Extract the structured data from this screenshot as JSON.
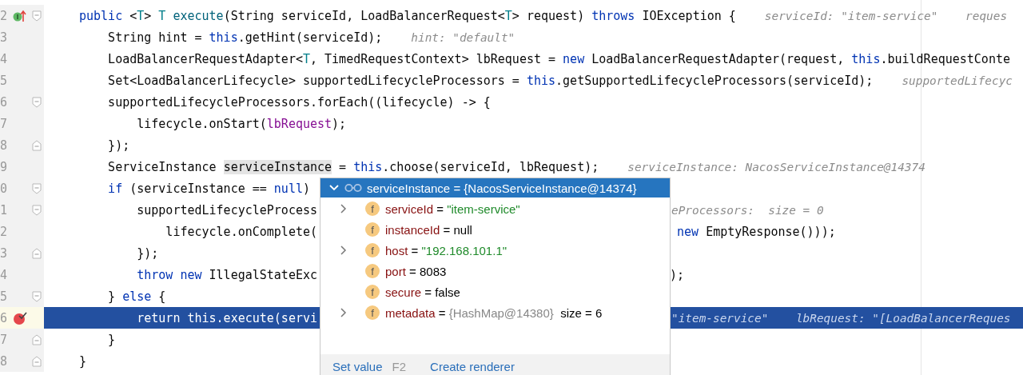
{
  "editor": {
    "lines": [
      {
        "number": "2",
        "gutter_icon": {
          "kind": "implements"
        },
        "fold": {
          "kind": "start"
        },
        "current": false,
        "code": [
          {
            "kind": "kw",
            "t": "public "
          },
          {
            "kind": "text",
            "t": "<"
          },
          {
            "kind": "type",
            "t": "T"
          },
          {
            "kind": "text",
            "t": "> "
          },
          {
            "kind": "type",
            "t": "T "
          },
          {
            "kind": "fn",
            "t": "execute"
          },
          {
            "kind": "text",
            "t": "(String serviceId, LoadBalancerRequest<"
          },
          {
            "kind": "type",
            "t": "T"
          },
          {
            "kind": "text",
            "t": "> request) "
          },
          {
            "kind": "kw",
            "t": "throws "
          },
          {
            "kind": "text",
            "t": "IOException {"
          }
        ],
        "hint": "serviceId: \"item-service\"    reques"
      },
      {
        "number": "3",
        "current": false,
        "code": [
          {
            "kind": "text",
            "t": "    String hint = "
          },
          {
            "kind": "kw",
            "t": "this"
          },
          {
            "kind": "text",
            "t": ".getHint(serviceId);"
          }
        ],
        "hint": "hint: \"default\""
      },
      {
        "number": "4",
        "current": false,
        "code": [
          {
            "kind": "text",
            "t": "    LoadBalancerRequestAdapter<"
          },
          {
            "kind": "type",
            "t": "T"
          },
          {
            "kind": "text",
            "t": ", TimedRequestContext> lbRequest = "
          },
          {
            "kind": "kw",
            "t": "new "
          },
          {
            "kind": "text",
            "t": "LoadBalancerRequestAdapter(request, "
          },
          {
            "kind": "kw",
            "t": "this"
          },
          {
            "kind": "text",
            "t": ".buildRequestConte"
          }
        ]
      },
      {
        "number": "5",
        "current": false,
        "code": [
          {
            "kind": "text",
            "t": "    Set<LoadBalancerLifecycle> supportedLifecycleProcessors = "
          },
          {
            "kind": "kw",
            "t": "this"
          },
          {
            "kind": "text",
            "t": ".getSupportedLifecycleProcessors(serviceId);"
          }
        ],
        "hint": "supportedLifecyc"
      },
      {
        "number": "6",
        "fold": {
          "kind": "start"
        },
        "current": false,
        "code": [
          {
            "kind": "text",
            "t": "    supportedLifecycleProcessors.forEach((lifecycle) -> {"
          }
        ]
      },
      {
        "number": "7",
        "current": false,
        "code": [
          {
            "kind": "text",
            "t": "        lifecycle.onStart("
          },
          {
            "kind": "field",
            "t": "lbRequest"
          },
          {
            "kind": "text",
            "t": ");"
          }
        ]
      },
      {
        "number": "8",
        "fold": {
          "kind": "end"
        },
        "current": false,
        "code": [
          {
            "kind": "text",
            "t": "    });"
          }
        ]
      },
      {
        "number": "9",
        "current": false,
        "code": [
          {
            "kind": "text",
            "t": "    ServiceInstance "
          },
          {
            "kind": "usage",
            "t": "serviceInstance"
          },
          {
            "kind": "text",
            "t": " = "
          },
          {
            "kind": "kw",
            "t": "this"
          },
          {
            "kind": "text",
            "t": ".choose(serviceId, lbRequest);"
          }
        ],
        "hint": "serviceInstance: NacosServiceInstance@14374"
      },
      {
        "number": "0",
        "fold": {
          "kind": "start"
        },
        "current": false,
        "code": [
          {
            "kind": "kw",
            "t": "    if "
          },
          {
            "kind": "text",
            "t": "(serviceInstance == "
          },
          {
            "kind": "kw",
            "t": "null"
          },
          {
            "kind": "text",
            "t": ")"
          }
        ]
      },
      {
        "number": "1",
        "fold": {
          "kind": "start"
        },
        "current": false,
        "code": [
          {
            "kind": "text",
            "t": "        supportedLifecycleProcess"
          }
        ],
        "tail_hint": "eProcessors:  size = 0"
      },
      {
        "number": "2",
        "current": false,
        "code": [
          {
            "kind": "text",
            "t": "            lifecycle.onComplete("
          }
        ],
        "tail_code": [
          {
            "kind": "kw",
            "t": " new "
          },
          {
            "kind": "text",
            "t": "EmptyResponse()));"
          }
        ]
      },
      {
        "number": "3",
        "fold": {
          "kind": "end"
        },
        "current": false,
        "code": [
          {
            "kind": "text",
            "t": "        });"
          }
        ]
      },
      {
        "number": "4",
        "current": false,
        "code": [
          {
            "kind": "kw",
            "t": "        throw new "
          },
          {
            "kind": "text",
            "t": "IllegalStateExc"
          }
        ],
        "tail_code": [
          {
            "kind": "text",
            "t": ");"
          }
        ]
      },
      {
        "number": "5",
        "fold": {
          "kind": "start"
        },
        "current": false,
        "code": [
          {
            "kind": "text",
            "t": "    } "
          },
          {
            "kind": "kw",
            "t": "else "
          },
          {
            "kind": "text",
            "t": "{"
          }
        ]
      },
      {
        "number": "6",
        "gutter_icon": {
          "kind": "breakpoint"
        },
        "current": true,
        "code": [
          {
            "kind": "text",
            "t": "        return this.execute(servi"
          }
        ],
        "tail_hint": "\"item-service\"    lbRequest: \"[LoadBalancerReques"
      },
      {
        "number": "7",
        "fold": {
          "kind": "end"
        },
        "current": false,
        "code": [
          {
            "kind": "text",
            "t": "    }"
          }
        ]
      },
      {
        "number": "8",
        "fold": {
          "kind": "end"
        },
        "current": false,
        "code": [
          {
            "kind": "text",
            "t": "}"
          }
        ]
      }
    ]
  },
  "popup": {
    "expanded": true,
    "title": "serviceInstance = {NacosServiceInstance@14374}",
    "fields": [
      {
        "expandable": true,
        "icon": "f",
        "name": "serviceId",
        "op": "=",
        "value": "\"item-service\"",
        "kind": "string"
      },
      {
        "expandable": false,
        "icon": "f",
        "name": "instanceId",
        "op": "=",
        "value": "null",
        "kind": "plain"
      },
      {
        "expandable": true,
        "icon": "f",
        "name": "host",
        "op": "=",
        "value": "\"192.168.101.1\"",
        "kind": "string"
      },
      {
        "expandable": false,
        "icon": "f",
        "name": "port",
        "op": "=",
        "value": "8083",
        "kind": "plain"
      },
      {
        "expandable": false,
        "icon": "f",
        "name": "secure",
        "op": "=",
        "value": "false",
        "kind": "plain"
      },
      {
        "expandable": true,
        "icon": "f",
        "name": "metadata",
        "op": "=",
        "value": "{HashMap@14380}",
        "kind": "ref",
        "extra": "size = 6"
      }
    ],
    "footer": {
      "set_value": "Set value",
      "shortcut": "F2",
      "create_renderer": "Create renderer"
    }
  }
}
